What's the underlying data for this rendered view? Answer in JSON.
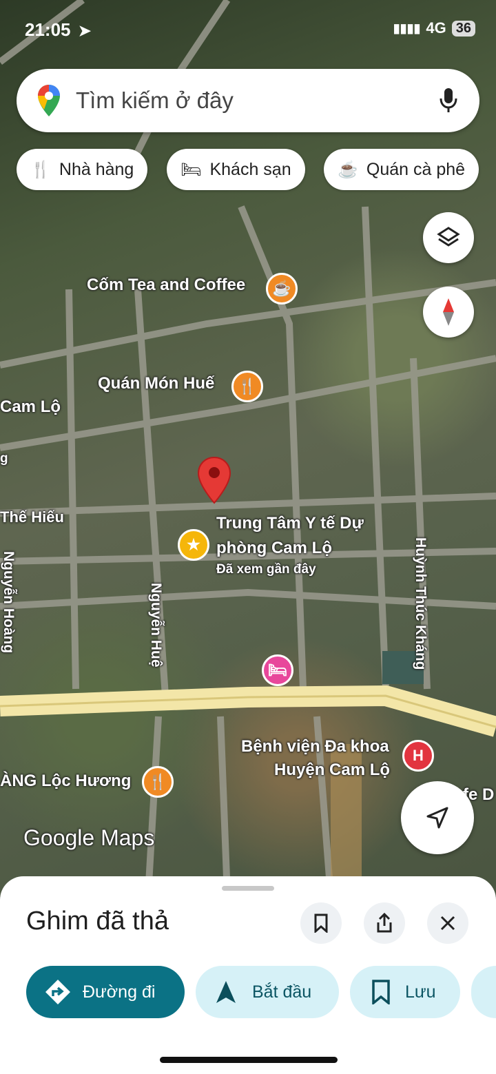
{
  "status": {
    "time": "21:05",
    "network": "4G",
    "battery": "36"
  },
  "search": {
    "placeholder": "Tìm kiếm ở đây"
  },
  "chips": [
    {
      "label": "Nhà hàng",
      "icon": "restaurant-icon"
    },
    {
      "label": "Khách sạn",
      "icon": "hotel-icon"
    },
    {
      "label": "Quán cà phê",
      "icon": "coffee-icon"
    }
  ],
  "map_labels": {
    "cafe": "Cốm Tea and Coffee",
    "restaurant1": "Quán Món Huế",
    "area1": "Cam Lộ",
    "street1": "Thế Hiếu",
    "street_nguyen_hoang": "Nguyễn Hoàng",
    "street_nguyen_hue": "Nguyễn Huệ",
    "street_huynh": "Huỳnh Thúc Kháng",
    "place_title_line1": "Trung Tâm Y tế Dự",
    "place_title_line2": "phòng Cam Lộ",
    "place_sub": "Đã xem gần đây",
    "hospital_line1": "Bệnh viện Đa khoa",
    "hospital_line2": "Huyện Cam Lộ",
    "restaurant2": "ÀNG Lộc Hương",
    "edge_right": "fe D",
    "edge_left": "g",
    "google_maps": "Google Maps"
  },
  "sheet": {
    "title": "Ghim đã thả",
    "buttons": [
      {
        "label": "Đường đi",
        "icon": "directions-icon"
      },
      {
        "label": "Bắt đầu",
        "icon": "navigation-arrow-icon"
      },
      {
        "label": "Lưu",
        "icon": "bookmark-icon"
      }
    ]
  },
  "colors": {
    "teal": "#0b7285",
    "pill_light": "#d6f1f7",
    "poi_orange": "#f08a24",
    "hotel_pink": "#e8479b",
    "hospital_red": "#e2343f",
    "pin_red": "#e53935"
  }
}
